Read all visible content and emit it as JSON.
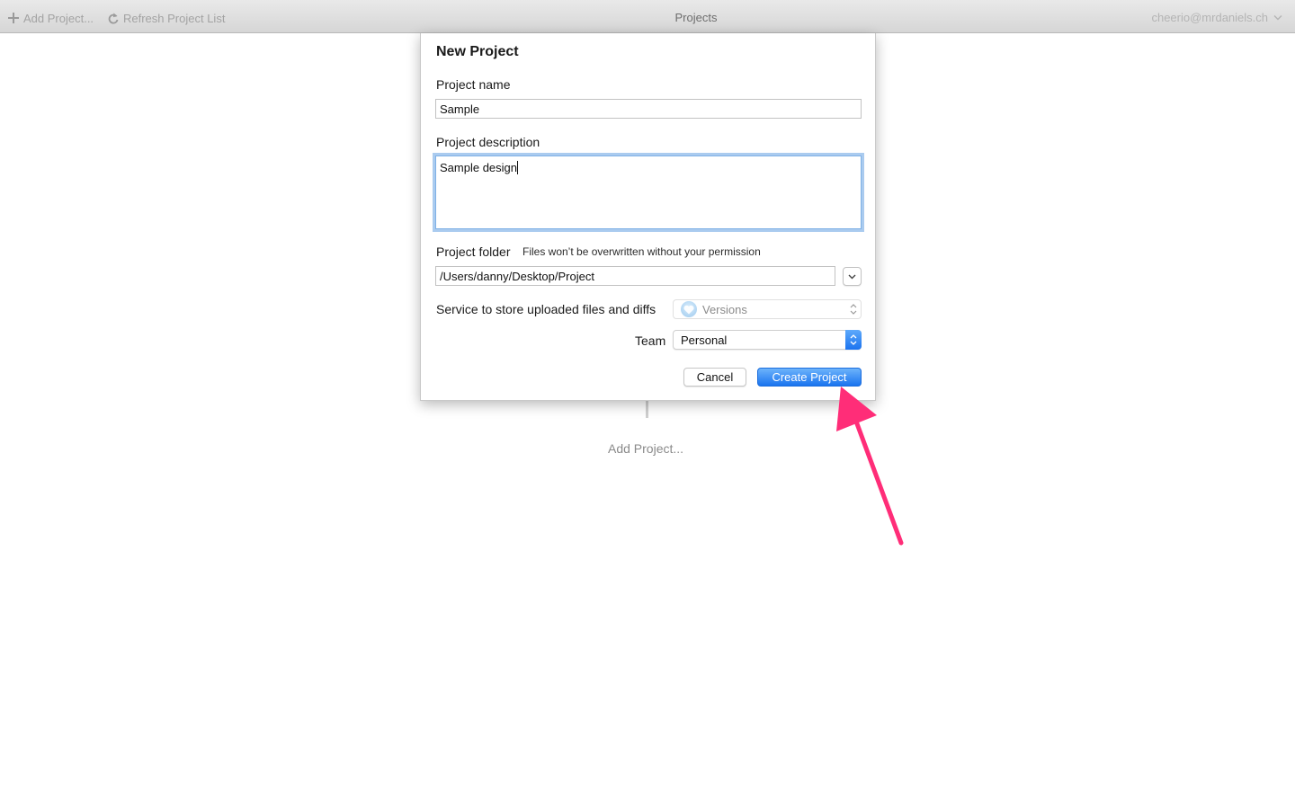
{
  "toolbar": {
    "add_project_label": "Add Project...",
    "refresh_label": "Refresh Project List",
    "title": "Projects",
    "user_email": "cheerio@mrdaniels.ch"
  },
  "background": {
    "add_project_label": "Add Project..."
  },
  "dialog": {
    "title": "New Project",
    "project_name_label": "Project name",
    "project_name_value": "Sample",
    "project_description_label": "Project description",
    "project_description_value": "Sample design",
    "project_folder_label": "Project folder",
    "project_folder_note": "Files won’t be overwritten without your permission",
    "project_folder_value": "/Users/danny/Desktop/Project",
    "service_label": "Service to store uploaded files and diffs",
    "service_value": "Versions",
    "team_label": "Team",
    "team_value": "Personal",
    "cancel_label": "Cancel",
    "create_label": "Create Project"
  },
  "colors": {
    "accent": "#1a74ef",
    "annotation_arrow": "#ff2d78",
    "focus_ring": "#aacbef"
  },
  "icons": {
    "add": "plus-icon",
    "refresh": "refresh-icon",
    "user_menu": "chevron-down-icon",
    "folder_dropdown": "chevron-down-icon",
    "service": "versions-logo-icon",
    "select_arrows": "up-down-arrows-icon"
  }
}
